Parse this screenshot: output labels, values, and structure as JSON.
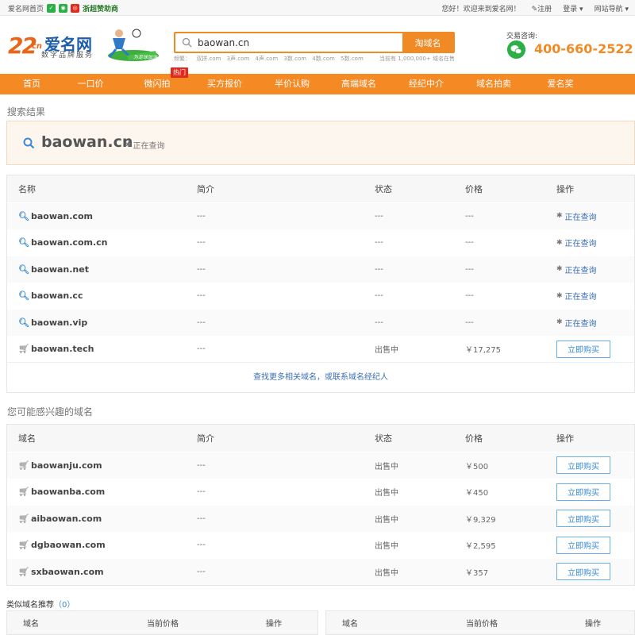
{
  "topbar": {
    "home_link": "爱名网首页",
    "sponsor_link": "浙超赞助商",
    "welcome": "您好！欢迎来到爱名网！",
    "register": "注册",
    "login": "登录",
    "site_nav": "网站导航"
  },
  "header": {
    "logo_number": "22",
    "logo_suffix": "cn",
    "logo_name": "爱名网",
    "logo_tagline": "数字品牌服务",
    "mascot_banner": "为足球加油",
    "search": {
      "value": "baowan.cn",
      "button": "淘域名",
      "hint_prefix": "频繁：",
      "hints": [
        "双拼.com",
        "3声.com",
        "4声.com",
        "3数.com",
        "4数.com",
        "5数.com"
      ],
      "count_text": "当前有 1,000,000+ 域名在售"
    },
    "contact_label": "交易咨询:",
    "phone": "400-660-2522",
    "colors": {
      "accent": "#f58a25",
      "link": "#3a6fb5",
      "hot": "#e02a1e"
    }
  },
  "nav": {
    "items": [
      "首页",
      "一口价",
      "微闪拍",
      "买方报价",
      "半价认购",
      "高端域名",
      "经纪中介",
      "域名拍卖",
      "爱名奖"
    ],
    "hot_badge": "热门"
  },
  "search_result": {
    "section_title": "搜索结果",
    "domain": "baowan.cn",
    "status": "正在查询"
  },
  "results_table": {
    "headers": [
      "名称",
      "简介",
      "状态",
      "价格",
      "操作"
    ],
    "rows": [
      {
        "domain": "baowan.com",
        "intro": "---",
        "status": "---",
        "price": "---",
        "action": "正在查询"
      },
      {
        "domain": "baowan.com.cn",
        "intro": "---",
        "status": "---",
        "price": "---",
        "action": "正在查询"
      },
      {
        "domain": "baowan.net",
        "intro": "---",
        "status": "---",
        "price": "---",
        "action": "正在查询"
      },
      {
        "domain": "baowan.cc",
        "intro": "---",
        "status": "---",
        "price": "---",
        "action": "正在查询"
      },
      {
        "domain": "baowan.vip",
        "intro": "---",
        "status": "---",
        "price": "---",
        "action": "正在查询"
      },
      {
        "domain": "baowan.tech",
        "intro": "---",
        "status": "出售中",
        "price": "￥17,275",
        "action": "立即购买"
      }
    ],
    "more_link_a": "查找更多相关域名",
    "more_sep": "，或",
    "more_link_b": "联系域名经纪人"
  },
  "interest": {
    "section_title": "您可能感兴趣的域名",
    "headers": [
      "域名",
      "简介",
      "状态",
      "价格",
      "操作"
    ],
    "rows": [
      {
        "domain": "baowanju.com",
        "intro": "---",
        "status": "出售中",
        "price": "￥500",
        "action": "立即购买"
      },
      {
        "domain": "baowanba.com",
        "intro": "---",
        "status": "出售中",
        "price": "￥450",
        "action": "立即购买"
      },
      {
        "domain": "aibaowan.com",
        "intro": "---",
        "status": "出售中",
        "price": "￥9,329",
        "action": "立即购买"
      },
      {
        "domain": "dgbaowan.com",
        "intro": "---",
        "status": "出售中",
        "price": "￥2,595",
        "action": "立即购买"
      },
      {
        "domain": "sxbaowan.com",
        "intro": "---",
        "status": "出售中",
        "price": "￥357",
        "action": "立即购买"
      }
    ]
  },
  "similar": {
    "title": "类似域名推荐",
    "count_open": "（",
    "count": "0",
    "count_close": "）",
    "headers": [
      "域名",
      "当前价格",
      "操作"
    ]
  }
}
